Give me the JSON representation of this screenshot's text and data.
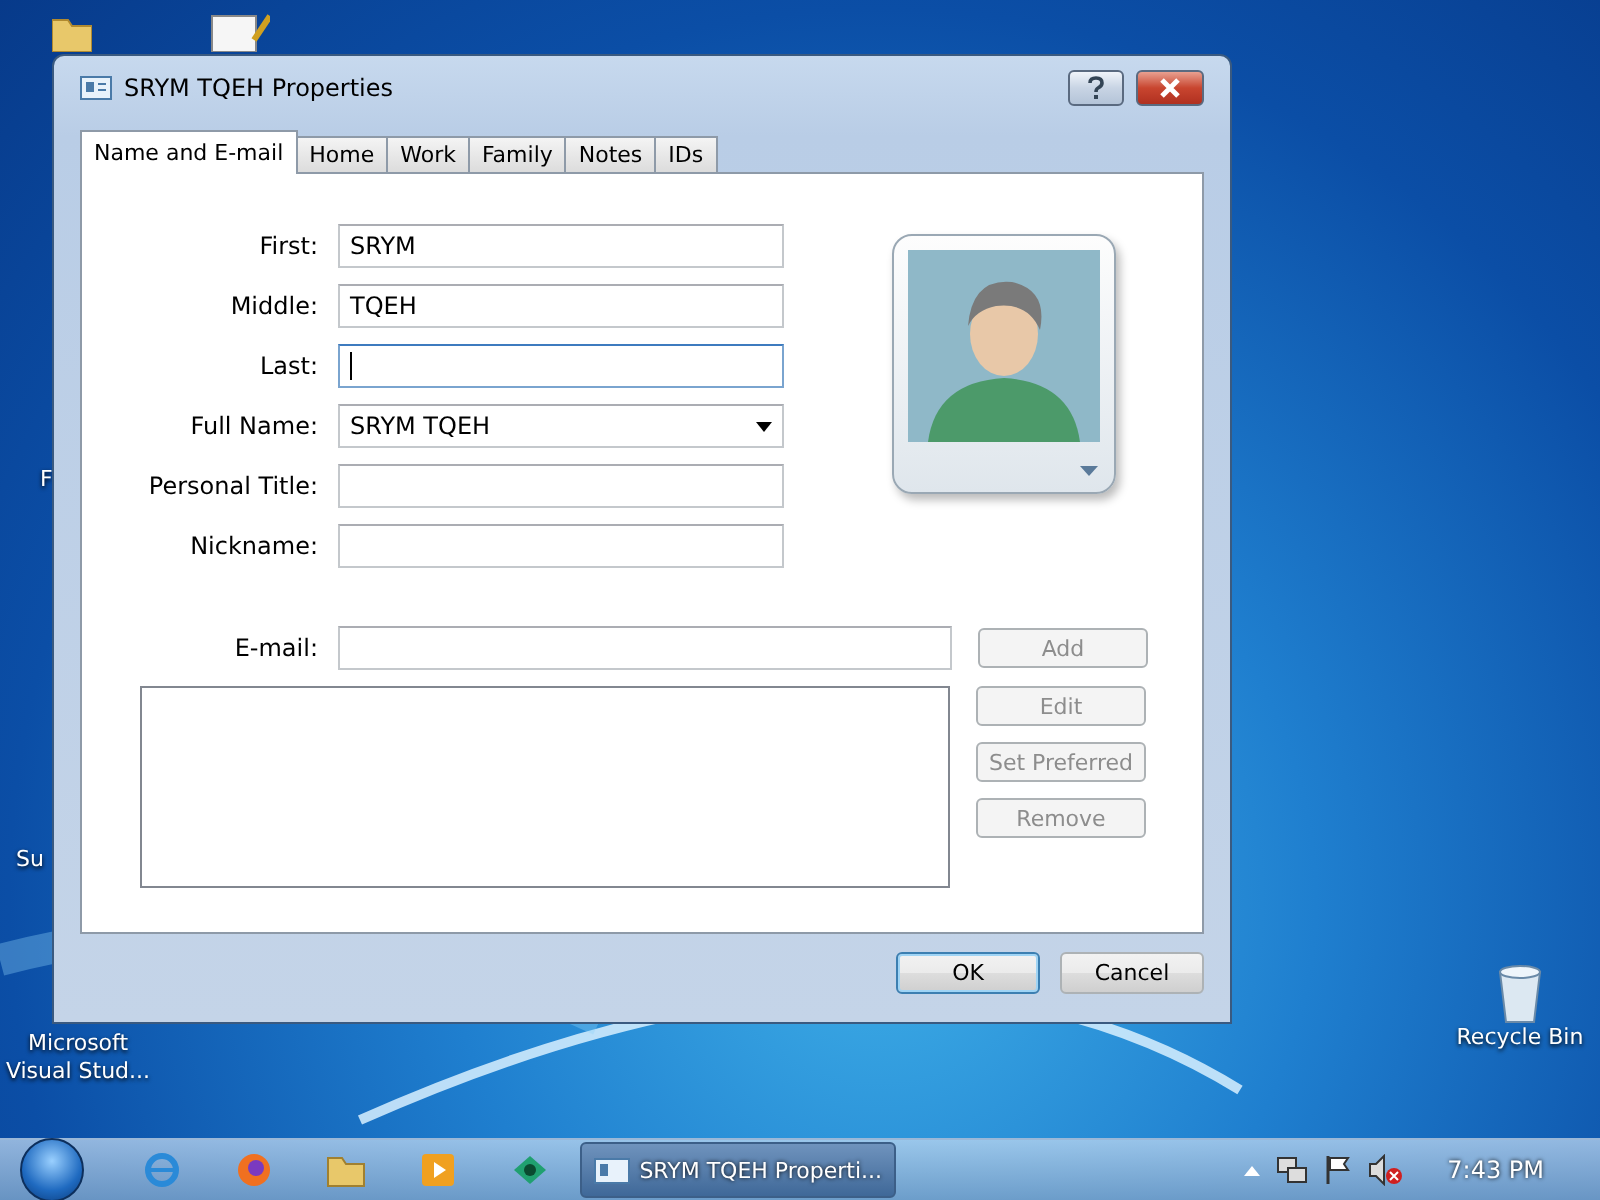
{
  "desktop": {
    "icons": [
      {
        "label": "F",
        "kind": "partial"
      },
      {
        "label": "Su",
        "kind": "partial"
      },
      {
        "label": "Microsoft Visual Stud...",
        "kind": "app"
      },
      {
        "label": "Recycle Bin",
        "kind": "bin"
      }
    ]
  },
  "window": {
    "title": "SRYM TQEH Properties",
    "tabs": [
      {
        "label": "Name and E-mail",
        "selected": true
      },
      {
        "label": "Home",
        "selected": false
      },
      {
        "label": "Work",
        "selected": false
      },
      {
        "label": "Family",
        "selected": false
      },
      {
        "label": "Notes",
        "selected": false
      },
      {
        "label": "IDs",
        "selected": false
      }
    ],
    "fields": [
      {
        "label": "First:",
        "value": "SRYM",
        "kind": "text",
        "focused": false
      },
      {
        "label": "Middle:",
        "value": "TQEH",
        "kind": "text",
        "focused": false
      },
      {
        "label": "Last:",
        "kind": "text",
        "focused": true
      },
      {
        "label": "Full Name:",
        "value": "SRYM TQEH",
        "kind": "dropdown",
        "focused": false
      },
      {
        "label": "Personal Title:",
        "kind": "text",
        "focused": false
      },
      {
        "label": "Nickname:",
        "kind": "text",
        "focused": false
      }
    ],
    "email": {
      "label": "E-mail:",
      "buttons": [
        {
          "label": "Add",
          "disabled": true
        },
        {
          "label": "Edit",
          "disabled": true
        },
        {
          "label": "Set Preferred",
          "disabled": true
        },
        {
          "label": "Remove",
          "disabled": true
        }
      ]
    },
    "buttons": [
      {
        "label": "OK",
        "default": true
      },
      {
        "label": "Cancel",
        "default": false
      }
    ]
  },
  "taskbar": {
    "window_button": {
      "label": "SRYM TQEH Properti...",
      "selected": true
    },
    "clock": "7:43 PM"
  }
}
